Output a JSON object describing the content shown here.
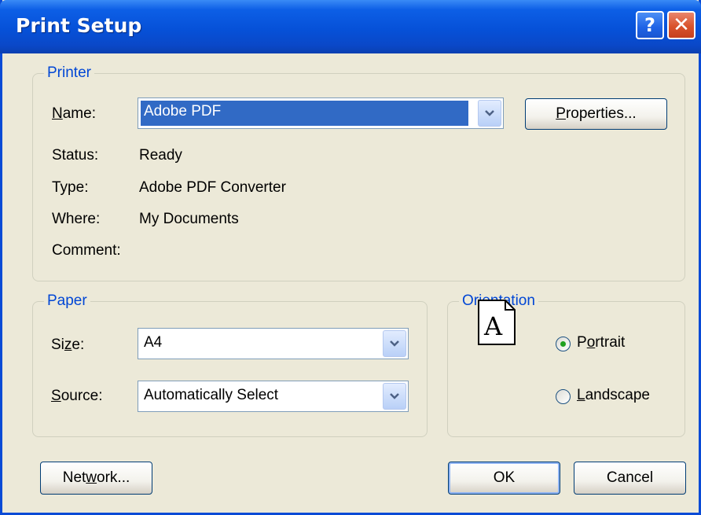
{
  "window": {
    "title": "Print Setup",
    "help_label": "?",
    "close_label": "✕"
  },
  "printer": {
    "legend": "Printer",
    "name_label": "Name:",
    "name_value": "Adobe PDF",
    "properties_button": "Properties...",
    "status_label": "Status:",
    "status_value": "Ready",
    "type_label": "Type:",
    "type_value": "Adobe PDF Converter",
    "where_label": "Where:",
    "where_value": "My Documents",
    "comment_label": "Comment:",
    "comment_value": ""
  },
  "paper": {
    "legend": "Paper",
    "size_label": "Size:",
    "size_value": "A4",
    "source_label": "Source:",
    "source_value": "Automatically Select"
  },
  "orientation": {
    "legend": "Orientation",
    "page_glyph": "A",
    "portrait_label": "Portrait",
    "landscape_label": "Landscape",
    "selected": "Portrait"
  },
  "buttons": {
    "network": "Network...",
    "ok": "OK",
    "cancel": "Cancel"
  },
  "colors": {
    "titlebar": "#0a4bd6",
    "legend_text": "#0046d5",
    "selection": "#316ac5",
    "face": "#ece9d8"
  },
  "icons": [
    "help-icon",
    "close-icon",
    "chevron-down-icon",
    "page-portrait-icon",
    "radio-selected-icon",
    "radio-empty-icon"
  ]
}
